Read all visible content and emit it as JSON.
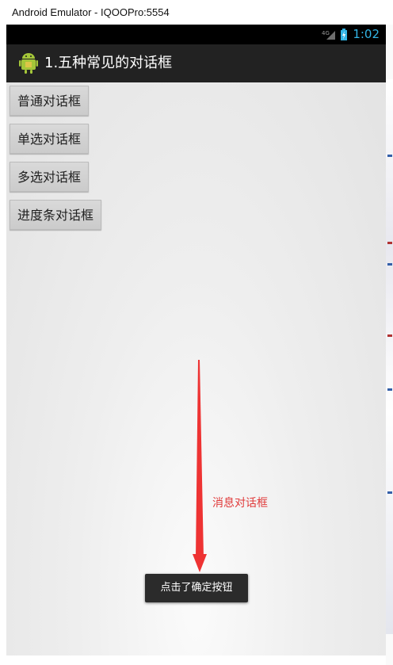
{
  "window": {
    "title": "Android Emulator - IQOOPro:5554"
  },
  "status_bar": {
    "network": "4G",
    "time": "1:02",
    "clock_color": "#33b5e5"
  },
  "action_bar": {
    "title": "1.五种常见的对话框",
    "icon": "android-robot-icon"
  },
  "buttons": [
    {
      "label": "普通对话框"
    },
    {
      "label": "单选对话框"
    },
    {
      "label": "多选对话框"
    },
    {
      "label": "进度条对话框"
    }
  ],
  "annotation": {
    "label": "消息对话框",
    "color": "#e03a3a"
  },
  "toast": {
    "text": "点击了确定按钮"
  }
}
